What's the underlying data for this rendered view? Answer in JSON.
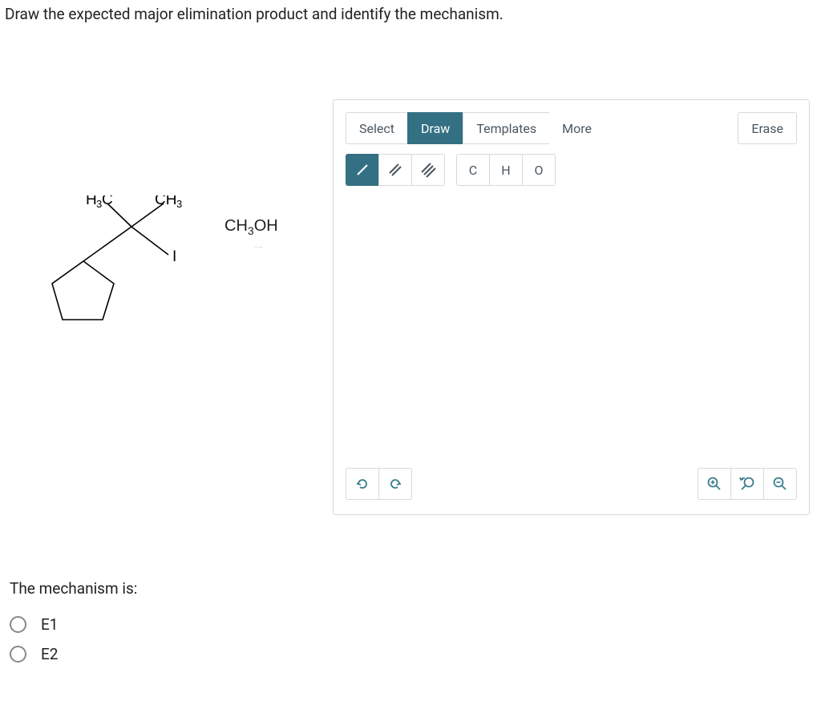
{
  "question": "Draw the expected major elimination product and identify the mechanism.",
  "editor": {
    "tabs": {
      "select": "Select",
      "draw": "Draw",
      "templates": "Templates",
      "more": "More",
      "erase": "Erase"
    },
    "atoms": {
      "c": "C",
      "h": "H",
      "o": "O"
    }
  },
  "reaction": {
    "reagentHtml": "CH<sub>3</sub>OH",
    "reagent": "CH3OH"
  },
  "mechanism": {
    "label": "The mechanism is:",
    "options": {
      "e1": "E1",
      "e2": "E2"
    }
  }
}
